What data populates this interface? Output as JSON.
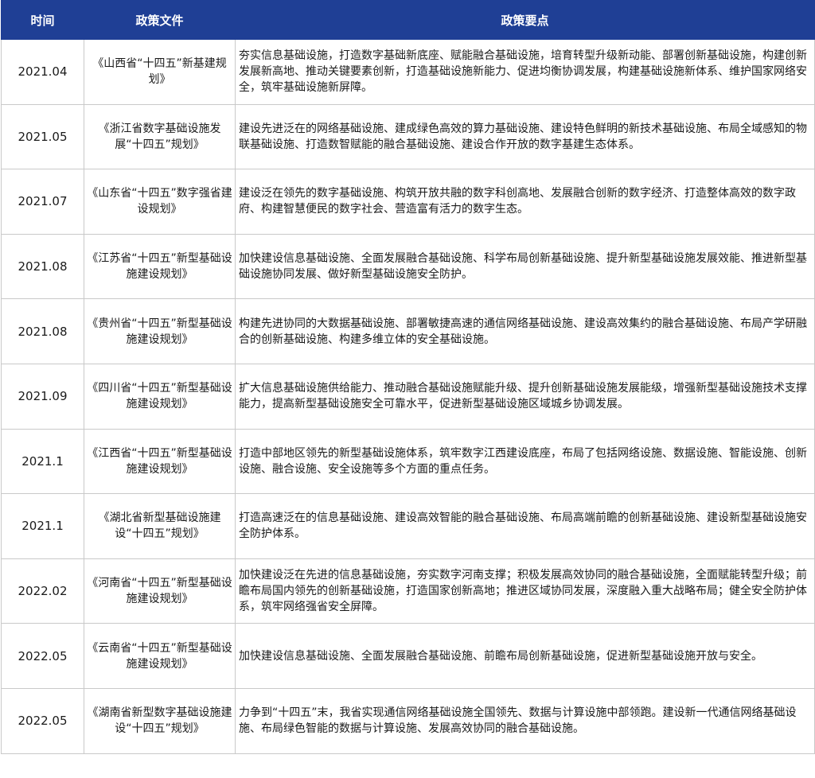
{
  "header": {
    "col_time": "时间",
    "col_doc": "政策文件",
    "col_points": "政策要点"
  },
  "rows": [
    {
      "date": "2021.04",
      "doc": "《山西省“十四五”新基建规划》",
      "points": "夯实信息基础设施，打造数字基础新底座、赋能融合基础设施，培育转型升级新动能、部署创新基础设施，构建创新发展新高地、推动关键要素创新，打造基础设施新能力、促进均衡协调发展，构建基础设施新体系、维护国家网络安全，筑牢基础设施新屏障。"
    },
    {
      "date": "2021.05",
      "doc": "《浙江省数字基础设施发展“十四五”规划》",
      "points": "建设先进泛在的网络基础设施、建成绿色高效的算力基础设施、建设特色鲜明的新技术基础设施、布局全域感知的物联基础设施、打造数智赋能的融合基础设施、建设合作开放的数字基建生态体系。"
    },
    {
      "date": "2021.07",
      "doc": "《山东省“十四五”数字强省建设规划》",
      "points": "建设泛在领先的数字基础设施、构筑开放共融的数字科创高地、发展融合创新的数字经济、打造整体高效的数字政府、构建智慧便民的数字社会、营造富有活力的数字生态。"
    },
    {
      "date": "2021.08",
      "doc": "《江苏省“十四五”新型基础设施建设规划》",
      "points": "加快建设信息基础设施、全面发展融合基础设施、科学布局创新基础设施、提升新型基础设施发展效能、推进新型基础设施协同发展、做好新型基础设施安全防护。"
    },
    {
      "date": "2021.08",
      "doc": "《贵州省“十四五”新型基础设施建设规划》",
      "points": "构建先进协同的大数据基础设施、部署敏捷高速的通信网络基础设施、建设高效集约的融合基础设施、布局产学研融合的创新基础设施、构建多维立体的安全基础设施。"
    },
    {
      "date": "2021.09",
      "doc": "《四川省“十四五”新型基础设施建设规划》",
      "points": "扩大信息基础设施供给能力、推动融合基础设施赋能升级、提升创新基础设施发展能级，增强新型基础设施技术支撑能力，提高新型基础设施安全可靠水平，促进新型基础设施区域城乡协调发展。"
    },
    {
      "date": "2021.1",
      "doc": "《江西省“十四五”新型基础设施建设规划》",
      "points": "打造中部地区领先的新型基础设施体系，筑牢数字江西建设底座，布局了包括网络设施、数据设施、智能设施、创新设施、融合设施、安全设施等多个方面的重点任务。"
    },
    {
      "date": "2021.1",
      "doc": "《湖北省新型基础设施建设“十四五”规划》",
      "points": "打造高速泛在的信息基础设施、建设高效智能的融合基础设施、布局高端前瞻的创新基础设施、建设新型基础设施安全防护体系。"
    },
    {
      "date": "2022.02",
      "doc": "《河南省“十四五”新型基础设施建设规划》",
      "points": "加快建设泛在先进的信息基础设施，夯实数字河南支撑；积极发展高效协同的融合基础设施，全面赋能转型升级；前瞻布局国内领先的创新基础设施，打造国家创新高地；推进区域协同发展，深度融入重大战略布局；健全安全防护体系，筑牢网络强省安全屏障。"
    },
    {
      "date": "2022.05",
      "doc": "《云南省“十四五”新型基础设施建设规划》",
      "points": "加快建设信息基础设施、全面发展融合基础设施、前瞻布局创新基础设施，促进新型基础设施开放与安全。"
    },
    {
      "date": "2022.05",
      "doc": "《湖南省新型数字基础设施建设“十四五”规划》",
      "points": "力争到“十四五”末，我省实现通信网络基础设施全国领先、数据与计算设施中部领跑。建设新一代通信网络基础设施、布局绿色智能的数据与计算设施、发展高效协同的融合基础设施。"
    }
  ]
}
